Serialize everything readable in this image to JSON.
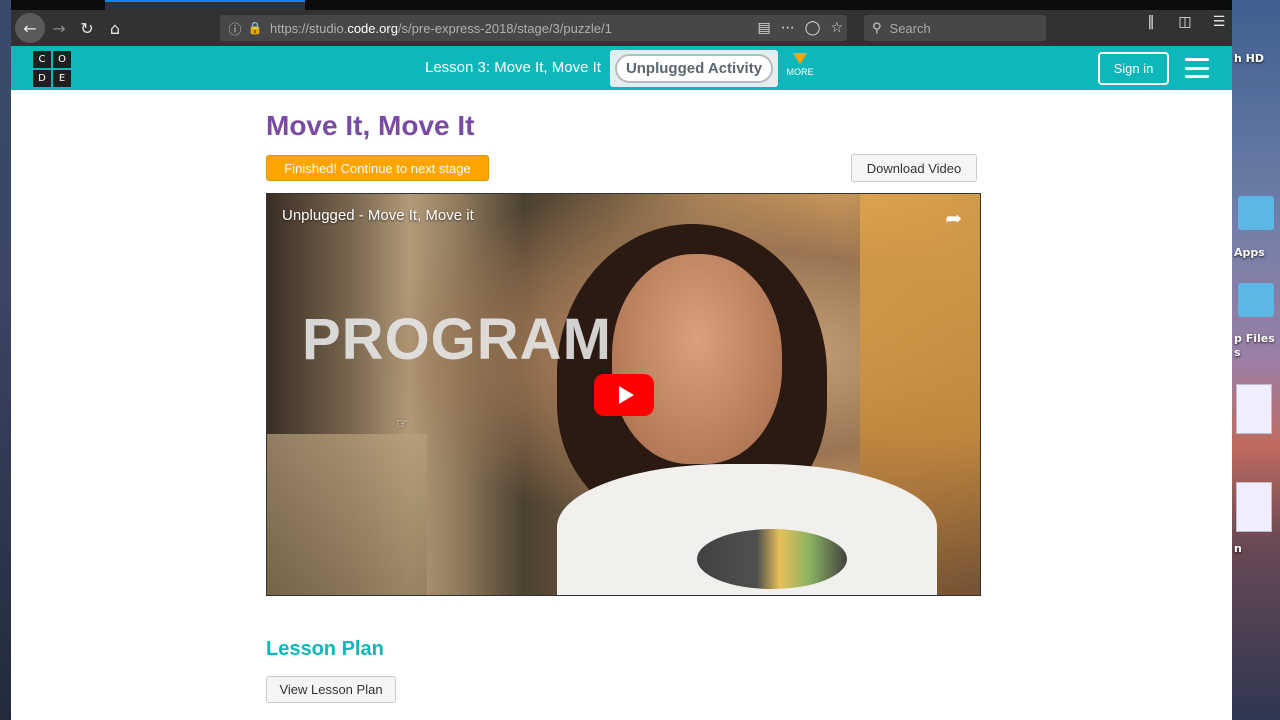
{
  "browser": {
    "url_prefix": "https://studio.",
    "url_domain": "code.org",
    "url_path": "/s/pre-express-2018/stage/3/puzzle/1",
    "search_placeholder": "Search"
  },
  "desktop": {
    "labels": [
      "h HD",
      "Apps",
      "p Files",
      "s",
      "n"
    ]
  },
  "header": {
    "logo_letters": [
      "C",
      "O",
      "D",
      "E"
    ],
    "lesson_title": "Lesson 3: Move It, Move It",
    "activity_label": "Unplugged Activity",
    "more_label": "MORE",
    "signin_label": "Sign in"
  },
  "main": {
    "title": "Move It, Move It",
    "finish_label": "Finished! Continue to next stage",
    "download_label": "Download Video",
    "video": {
      "title": "Unplugged - Move It, Move it",
      "overlay_text": "PROGRAM"
    },
    "lesson_plan_heading": "Lesson Plan",
    "lesson_plan_button": "View Lesson Plan"
  },
  "colors": {
    "header_teal": "#0eb7ba",
    "title_purple": "#7a4ba3",
    "finish_orange": "#ffa400",
    "play_red": "#ff0000"
  }
}
